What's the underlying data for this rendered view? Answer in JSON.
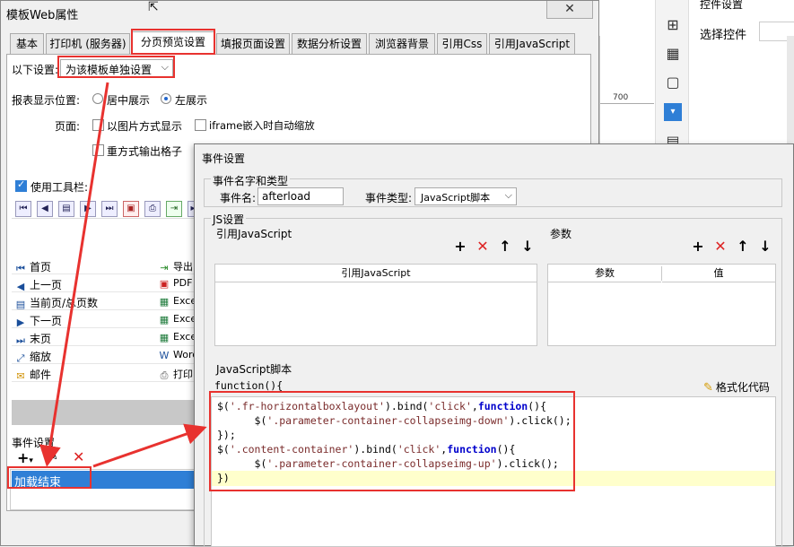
{
  "background": {
    "ruler_value": "700",
    "properties_title": "控件设置",
    "select_control_label": "选择控件"
  },
  "main_dialog": {
    "title": "模板Web属性",
    "tabs": [
      {
        "label": "基本"
      },
      {
        "label": "打印机 (服务器)"
      },
      {
        "label": "分页预览设置"
      },
      {
        "label": "填报页面设置"
      },
      {
        "label": "数据分析设置"
      },
      {
        "label": "浏览器背景"
      },
      {
        "label": "引用Css"
      },
      {
        "label": "引用JavaScript"
      }
    ],
    "active_tab": "分页预览设置",
    "mode_label": "以下设置:",
    "mode_value": "为该模板单独设置",
    "position_label": "报表显示位置:",
    "position_options": [
      "居中展示",
      "左展示"
    ],
    "position_selected": "左展示",
    "page_label": "页面:",
    "page_options": [
      "以图片方式显示",
      "iframe嵌入时自动缩放"
    ],
    "repeat_output_label": "重方式输出格子",
    "use_toolbar_label": "使用工具栏:",
    "use_toolbar_checked": true,
    "toolbar_buttons": [
      {
        "name": "first",
        "left": "首页",
        "right": "导出"
      },
      {
        "name": "prev",
        "left": "上一页",
        "right": "PDF"
      },
      {
        "name": "current",
        "left": "当前页/总页数",
        "right": "Excel"
      },
      {
        "name": "next",
        "left": "下一页",
        "right": "Excel"
      },
      {
        "name": "last",
        "left": "末页",
        "right": "Excel"
      },
      {
        "name": "zoom",
        "left": "缩放",
        "right": "Word"
      },
      {
        "name": "mail",
        "left": "邮件",
        "right": "打印"
      }
    ],
    "event_settings_label": "事件设置",
    "events": [
      "加载结束"
    ]
  },
  "event_dialog": {
    "title": "事件设置",
    "name_type_group": "事件名字和类型",
    "event_name_label": "事件名:",
    "event_name_value": "afterload",
    "event_type_label": "事件类型:",
    "event_type_value": "JavaScript脚本",
    "js_settings_group": "JS设置",
    "ref_js_label": "引用JavaScript",
    "params_label": "参数",
    "ref_js_header": "引用JavaScript",
    "params_headers": [
      "参数",
      "值"
    ],
    "script_label": "JavaScript脚本",
    "function_header": "function(){",
    "format_code_label": "格式化代码",
    "code_lines": [
      "$('.fr-horizontalboxlayout').bind('click',function(){",
      "      $('.parameter-container-collapseimg-down').click();",
      "});",
      "$('.content-container').bind('click',function(){",
      "      $('.parameter-container-collapseimg-up').click();",
      "})"
    ]
  },
  "colors": {
    "annotation_red": "#e8322f",
    "selection_blue": "#2f7fd6",
    "current_line_yellow": "#ffffcc"
  }
}
